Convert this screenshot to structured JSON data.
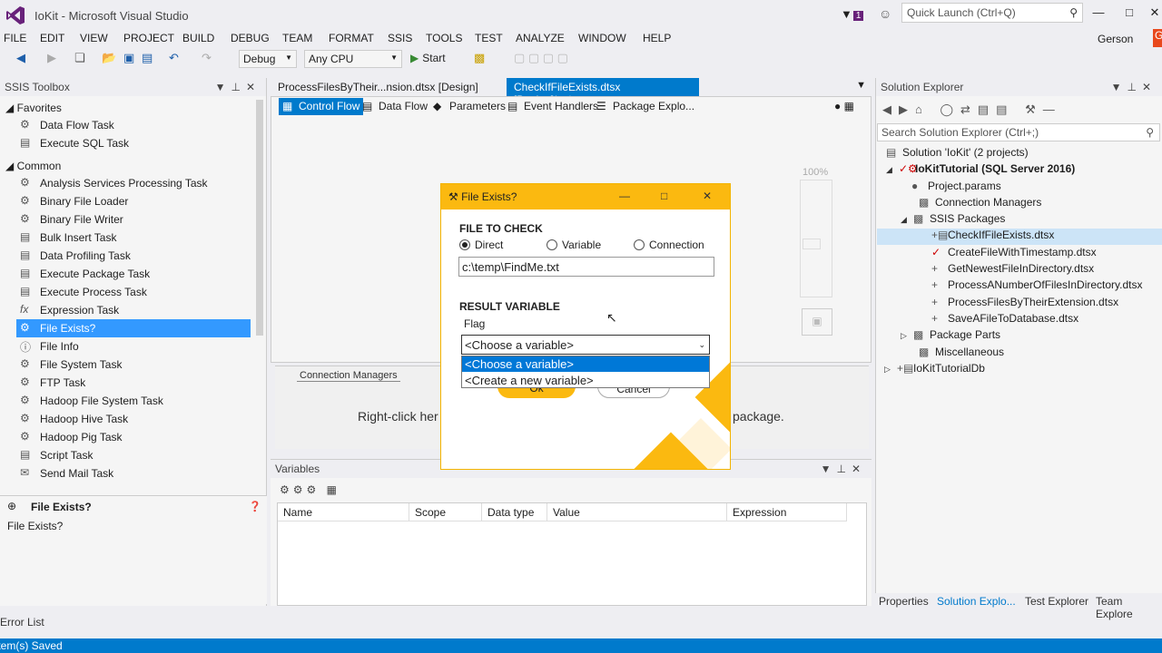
{
  "window": {
    "title": "IoKit - Microsoft Visual Studio",
    "notification_count": "1",
    "quick_launch_placeholder": "Quick Launch (Ctrl+Q)",
    "user": "Gerson"
  },
  "menu": [
    "FILE",
    "EDIT",
    "VIEW",
    "PROJECT",
    "BUILD",
    "DEBUG",
    "TEAM",
    "FORMAT",
    "SSIS",
    "TOOLS",
    "TEST",
    "ANALYZE",
    "WINDOW",
    "HELP"
  ],
  "toolbar": {
    "config": "Debug",
    "platform": "Any CPU",
    "start_label": "Start"
  },
  "toolbox": {
    "title": "SSIS Toolbox",
    "groups": [
      {
        "label": "Favorites",
        "items": [
          "Data Flow Task",
          "Execute SQL Task"
        ]
      },
      {
        "label": "Common",
        "items": [
          "Analysis Services Processing Task",
          "Binary File Loader",
          "Binary File Writer",
          "Bulk Insert Task",
          "Data Profiling Task",
          "Execute Package Task",
          "Execute Process Task",
          "Expression Task",
          "File Exists?",
          "File Info",
          "File System Task",
          "FTP Task",
          "Hadoop File System Task",
          "Hadoop Hive Task",
          "Hadoop Pig Task",
          "Script Task",
          "Send Mail Task"
        ]
      }
    ],
    "selected": "File Exists?",
    "description_title": "File Exists?",
    "description_text": "File Exists?"
  },
  "editor": {
    "tabs": [
      {
        "label": "ProcessFilesByTheir...nsion.dtsx [Design]",
        "active": false
      },
      {
        "label": "CheckIfFileExists.dtsx [Design]*",
        "active": true
      }
    ],
    "subtabs": [
      "Control Flow",
      "Data Flow",
      "Parameters",
      "Event Handlers",
      "Package Explo..."
    ],
    "zoom": "100%",
    "connection_managers_tab": "Connection Managers",
    "hint_left": "Right-click her",
    "hint_right": "package."
  },
  "variables": {
    "title": "Variables",
    "columns": [
      "Name",
      "Scope",
      "Data type",
      "Value",
      "Expression"
    ]
  },
  "solution_explorer": {
    "title": "Solution Explorer",
    "search_placeholder": "Search Solution Explorer (Ctrl+;)",
    "tree": [
      {
        "label": "Solution 'IoKit' (2 projects)",
        "level": 0
      },
      {
        "label": "IoKitTutorial (SQL Server 2016)",
        "level": 1,
        "bold": true
      },
      {
        "label": "Project.params",
        "level": 2
      },
      {
        "label": "Connection Managers",
        "level": 2
      },
      {
        "label": "SSIS Packages",
        "level": 2
      },
      {
        "label": "CheckIfFileExists.dtsx",
        "level": 3,
        "selected": true
      },
      {
        "label": "CreateFileWithTimestamp.dtsx",
        "level": 3
      },
      {
        "label": "GetNewestFileInDirectory.dtsx",
        "level": 3
      },
      {
        "label": "ProcessANumberOfFilesInDirectory.dtsx",
        "level": 3
      },
      {
        "label": "ProcessFilesByTheirExtension.dtsx",
        "level": 3
      },
      {
        "label": "SaveAFileToDatabase.dtsx",
        "level": 3
      },
      {
        "label": "Package Parts",
        "level": 2
      },
      {
        "label": "Miscellaneous",
        "level": 2
      },
      {
        "label": "IoKitTutorialDb",
        "level": 1
      }
    ],
    "bottom_tabs": [
      "Properties",
      "Solution Explo...",
      "Test Explorer",
      "Team Explore"
    ]
  },
  "error_list": "Error List",
  "status": "Item(s) Saved",
  "dialog": {
    "title": "File Exists?",
    "file_to_check": "FILE TO CHECK",
    "radio_direct": "Direct",
    "radio_variable": "Variable",
    "radio_connection": "Connection",
    "path": "c:\\temp\\FindMe.txt",
    "result_variable": "RESULT VARIABLE",
    "flag": "Flag",
    "selected_variable": "<Choose a variable>",
    "options": [
      "<Choose a variable>",
      "<Create a new variable>"
    ],
    "ok": "Ok",
    "cancel": "Cancel"
  }
}
